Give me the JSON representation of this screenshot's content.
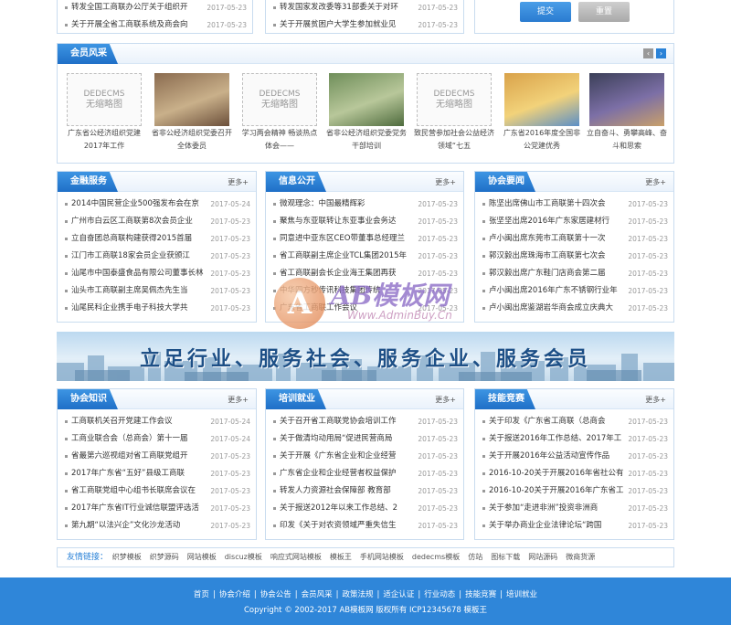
{
  "top": {
    "left_items": [
      {
        "title": "转发全国工商联办公厅关于组织开",
        "date": "2017-05-23"
      },
      {
        "title": "关于开展全省工商联系统及商会向",
        "date": "2017-05-23"
      }
    ],
    "mid_items": [
      {
        "title": "转发国家发改委等31部委关于对环",
        "date": "2017-05-23"
      },
      {
        "title": "关于开展贫困户大学生参加就业见",
        "date": "2017-05-23"
      }
    ],
    "submit": "提交",
    "reset": "重置"
  },
  "member": {
    "title": "会员风采",
    "items": [
      {
        "kind": "ph",
        "ph1": "DEDECMS",
        "ph2": "无缩略图",
        "cap": "广东省公经济组织党建2017年工作"
      },
      {
        "kind": "img",
        "cap": "省非公经济组织党委召开全体委员"
      },
      {
        "kind": "ph",
        "ph1": "DEDECMS",
        "ph2": "无缩略图",
        "cap": "学习两会精神 畅谈热点体会——"
      },
      {
        "kind": "img",
        "cap": "省非公经济组织党委党务干部培训"
      },
      {
        "kind": "ph",
        "ph1": "DEDECMS",
        "ph2": "无缩略图",
        "cap": "致民营参加社会公益经济领域“七五"
      },
      {
        "kind": "img",
        "cap": "广东省2016年度全国非公党建优秀"
      },
      {
        "kind": "img",
        "cap": "立自奋斗、勇攀高峰、奋斗和思索"
      }
    ]
  },
  "sections": [
    {
      "title": "金融服务",
      "more": "更多+",
      "items": [
        {
          "title": "2014中国民营企业500强发布会在京",
          "date": "2017-05-24"
        },
        {
          "title": "广州市白云区工商联第8次会员企业",
          "date": "2017-05-23"
        },
        {
          "title": "立自奋团总商联构建获得2015首届",
          "date": "2017-05-23"
        },
        {
          "title": "江门市工商联18家会员企业获颁江",
          "date": "2017-05-23"
        },
        {
          "title": "汕尾市中国泰盛食品有限公司董事长林",
          "date": "2017-05-23"
        },
        {
          "title": "汕头市工商联副主席吴佩杰先生当",
          "date": "2017-05-23"
        },
        {
          "title": "汕尾民科企业携手电子科技大学共",
          "date": "2017-05-23"
        }
      ]
    },
    {
      "title": "信息公开",
      "more": "更多+",
      "items": [
        {
          "title": "微观理念：中国最精辉彩",
          "date": "2017-05-23"
        },
        {
          "title": "聚焦与东亚联转让东亚事业会务达",
          "date": "2017-05-23"
        },
        {
          "title": "同意进中亚东区CEO带董事总经理兰",
          "date": "2017-05-23"
        },
        {
          "title": "省工商联副主席企业TCL集团2015年",
          "date": "2017-05-23"
        },
        {
          "title": "省工商联副会长企业海王集团再获",
          "date": "2017-05-23"
        },
        {
          "title": "中华四方秒传讯科技集团传统",
          "date": "2017-05-23"
        },
        {
          "title": "广东省工商联工作会议",
          "date": "2017-05-23"
        }
      ]
    },
    {
      "title": "协会要闻",
      "more": "更多+",
      "items": [
        {
          "title": "陈坚出席佛山市工商联第十四次会",
          "date": "2017-05-23"
        },
        {
          "title": "张坚坚出席2016年广东家居建材行",
          "date": "2017-05-23"
        },
        {
          "title": "卢小闽出席东莞市工商联第十一次",
          "date": "2017-05-23"
        },
        {
          "title": "郭汉毅出席珠海市工商联第七次会",
          "date": "2017-05-23"
        },
        {
          "title": "郭汉毅出席广东鞋门店商会第二届",
          "date": "2017-05-23"
        },
        {
          "title": "卢小闽出席2016年广东不锈钢行业年",
          "date": "2017-05-23"
        },
        {
          "title": "卢小闽出席鉴湖岩华商会成立庆典大",
          "date": "2017-05-23"
        }
      ]
    },
    {
      "title": "协会知识",
      "more": "更多+",
      "items": [
        {
          "title": "工商联机关召开党建工作会议",
          "date": "2017-05-24"
        },
        {
          "title": "工商业联合会（总商会）第十一届",
          "date": "2017-05-24"
        },
        {
          "title": "省最第六巡视组对省工商联党组开",
          "date": "2017-05-23"
        },
        {
          "title": "2017年广东省“五好”县级工商联",
          "date": "2017-05-23"
        },
        {
          "title": "省工商联党组中心组书长联席会议在",
          "date": "2017-05-23"
        },
        {
          "title": "2017年广东省IT行业诚信联盟评选活",
          "date": "2017-05-23"
        },
        {
          "title": "第九期“以法兴企”文化沙龙活动",
          "date": "2017-05-23"
        }
      ]
    },
    {
      "title": "培训就业",
      "more": "更多+",
      "items": [
        {
          "title": "关于召开省工商联党协会培训工作",
          "date": "2017-05-23"
        },
        {
          "title": "关于做清均动用局“促进民营商局",
          "date": "2017-05-23"
        },
        {
          "title": "关于开展《广东省企业和企业经营",
          "date": "2017-05-23"
        },
        {
          "title": "广东省企业和企业经营者权益保护",
          "date": "2017-05-23"
        },
        {
          "title": "转发人力资源社会保障部 教育部",
          "date": "2017-05-23"
        },
        {
          "title": "关于报送2012年以来工作总结、2",
          "date": "2017-05-23"
        },
        {
          "title": "印发《关于对农资领域严重失信生",
          "date": "2017-05-23"
        }
      ]
    },
    {
      "title": "技能竞赛",
      "more": "更多+",
      "items": [
        {
          "title": "关于印发《广东省工商联（总商会",
          "date": "2017-05-23"
        },
        {
          "title": "关于报送2016年工作总结、2017年工",
          "date": "2017-05-23"
        },
        {
          "title": "关于开展2016年公益活动宣传作品",
          "date": "2017-05-23"
        },
        {
          "title": "2016-10-20关于开展2016年省社公有组",
          "date": "2017-05-23"
        },
        {
          "title": "2016-10-20关于开展2016年广东省工商",
          "date": "2017-05-23"
        },
        {
          "title": "关于参加“走进非洲”投资非洲商",
          "date": "2017-05-23"
        },
        {
          "title": "关于举办商业企业法律论坛“跨国",
          "date": "2017-05-23"
        }
      ]
    }
  ],
  "banner": {
    "slogan": "立足行业、服务社会、服务企业、服务会员"
  },
  "watermark": {
    "brand": "AB模板网",
    "url": "Www.AdminBuy.Cn"
  },
  "links": {
    "label": "友情链接：",
    "items": [
      "织梦模板",
      "织梦源码",
      "网站模板",
      "discuz模板",
      "响应式网站模板",
      "模板王",
      "手机网站模板",
      "dedecms模板",
      "仿站",
      "图标下载",
      "网站源码",
      "微商货源"
    ]
  },
  "footer": {
    "nav": [
      "首页",
      "协会介绍",
      "协会公告",
      "会员风采",
      "政策法规",
      "适企认证",
      "行业动态",
      "技能竞赛",
      "培训就业"
    ],
    "sep": "|",
    "copyright": "Copyright © 2002-2017 AB模板网 版权所有 ICP12345678 模板王"
  },
  "colors": {
    "accent": "#2a82d7",
    "footer_bg": "#2f86d9"
  }
}
